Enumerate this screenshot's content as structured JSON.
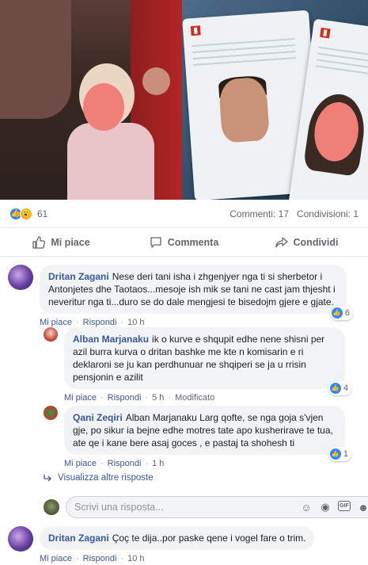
{
  "post": {
    "reactions": {
      "count": "61",
      "types": [
        "like",
        "wow"
      ]
    },
    "comments_count": "Commenti: 17",
    "shares_count": "Condivisioni: 1"
  },
  "actions": {
    "like": "Mi piace",
    "comment": "Commenta",
    "share": "Condividi"
  },
  "comments": [
    {
      "author": "Dritan Zagani",
      "text": "Nese deri tani isha i zhgenjyer nga ti si sherbetor i Antonjetes dhe Taotaos...mesoje ish mik se tani ne cast jam thjesht i neveritur nga ti...duro se do dale mengjesi te bisedojm gjere e gjate.",
      "like": "Mi piace",
      "reply": "Rispondi",
      "time": "10 h",
      "reactions": "6"
    },
    {
      "author": "Alban Marjanaku",
      "text": "ik o kurve e shqupit edhe nene shisni per azil burra kurva o dritan bashke me kte n komisarin e ri deklaroni se ju kan perdhunuar ne shqiperi se ja u rrisin pensjonin e azilit",
      "like": "Mi piace",
      "reply": "Rispondi",
      "time": "5 h",
      "edited": "Modificato",
      "reactions": "4"
    },
    {
      "author": "Qani Zeqiri",
      "text": "Alban Marjanaku Larg qofte, se nga goja s'vjen gje, po sikur ia bejne edhe motres tate apo kusherirave te tua, ate qe i kane bere asaj goces , e pastaj ta shohesh ti",
      "like": "Mi piace",
      "reply": "Rispondi",
      "time": "1 h",
      "reactions": "1"
    },
    {
      "author": "Dritan Zagani",
      "text": "Çoç te dija..por paske qene i vogel fare o trim.",
      "like": "Mi piace",
      "reply": "Rispondi",
      "time": "10 h"
    }
  ],
  "more_replies": "Visualizza altre risposte",
  "reply_placeholder": "Scrivi una risposta...",
  "colors": {
    "link": "#385898",
    "like_blue": "#2d88ff",
    "bubble": "#f2f3f5"
  }
}
